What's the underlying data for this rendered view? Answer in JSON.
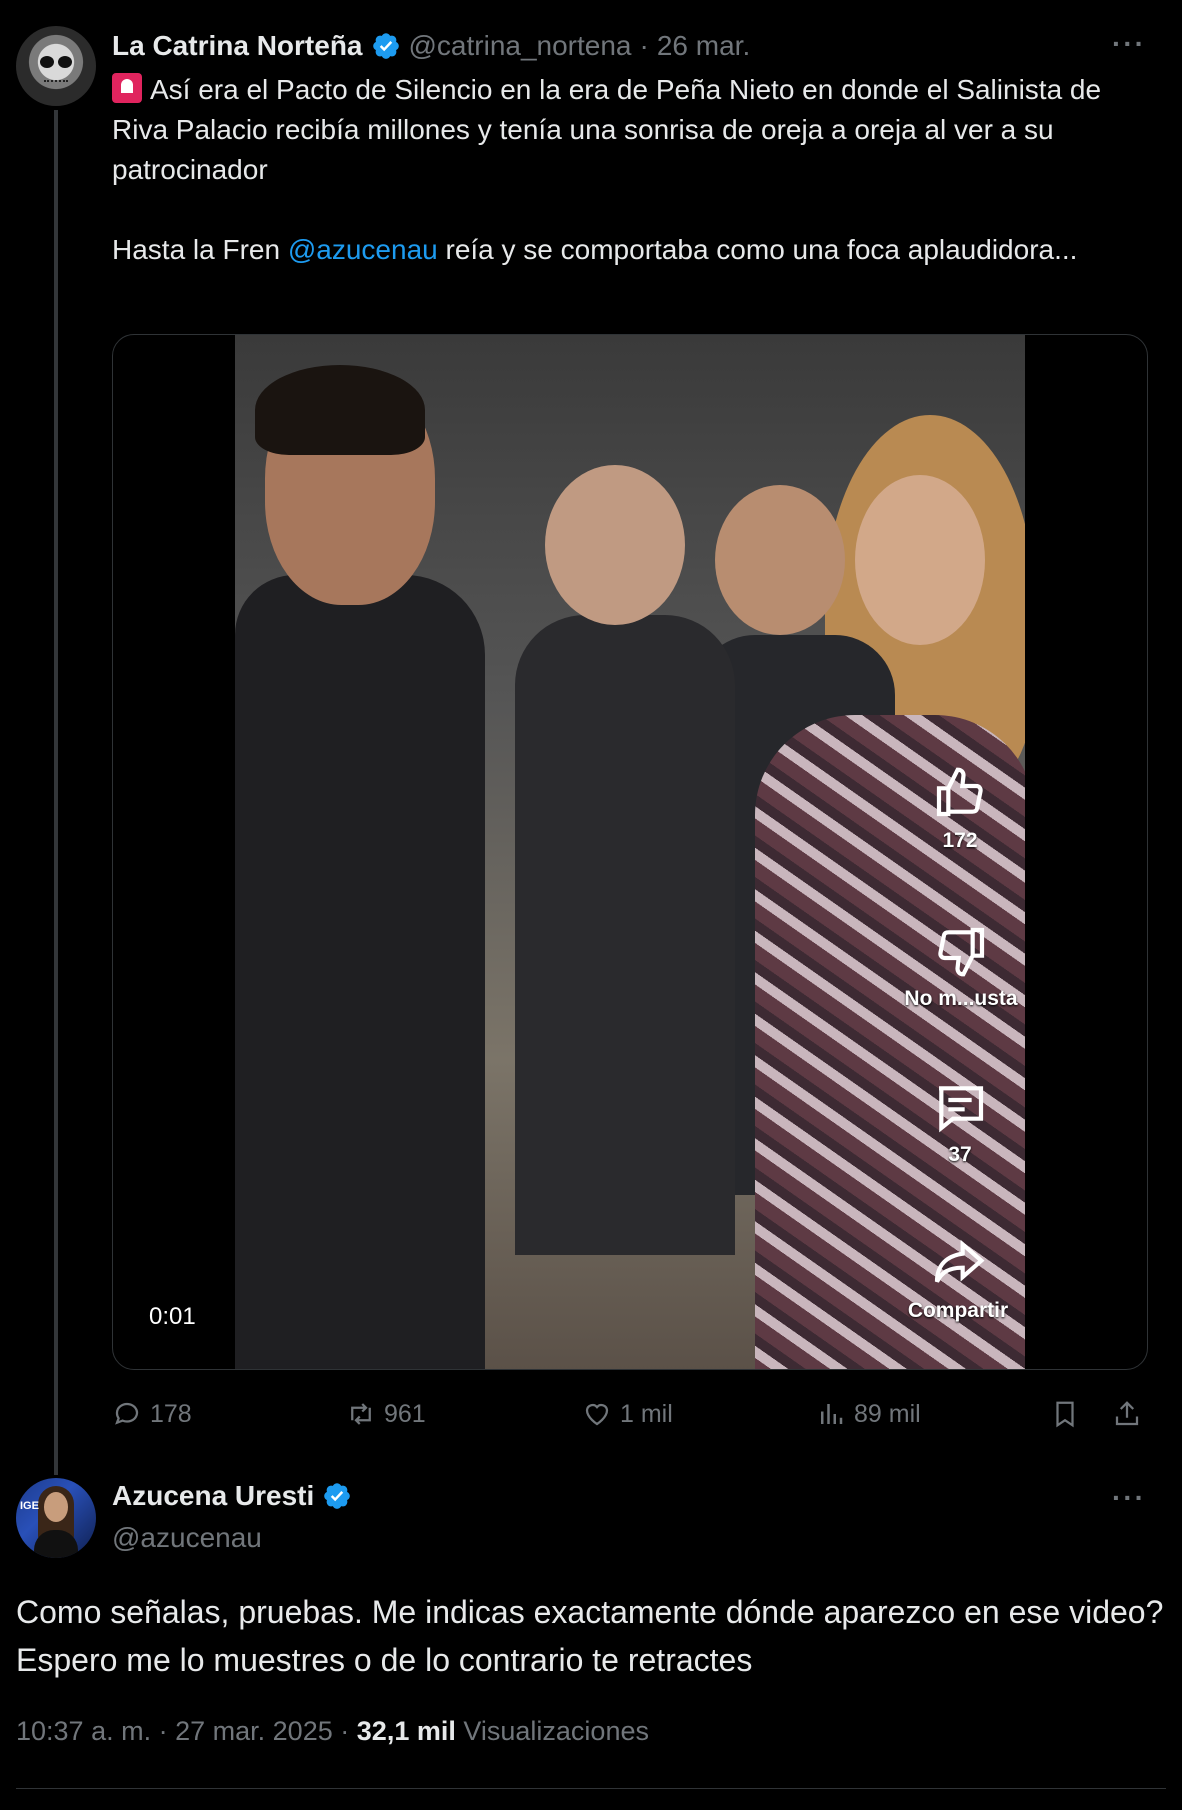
{
  "tweet1": {
    "name": "La Catrina Norteña",
    "handle": "@catrina_nortena",
    "separator": "·",
    "date": "26 mar.",
    "more": "···",
    "text_line1": "Así era el Pacto de Silencio en la era de Peña Nieto en donde el Salinista de Riva Palacio recibía millones y tenía una sonrisa de oreja a oreja al ver a su patrocinador",
    "text_line2_prefix": "Hasta la Fren ",
    "text_line2_mention": "@azucenau",
    "text_line2_suffix": " reía y se comportaba como una foca aplaudidora...",
    "video": {
      "time": "0:01",
      "like_count": "172",
      "dislike_label": "No m...usta",
      "comment_count": "37",
      "share_label": "Compartir"
    },
    "actions": {
      "replies": "178",
      "reposts": "961",
      "likes": "1 mil",
      "views": "89 mil"
    }
  },
  "tweet2": {
    "name": "Azucena Uresti",
    "handle": "@azucenau",
    "more": "···",
    "avatar_tag": "IGE",
    "text": "Como señalas, pruebas. Me indicas exactamente dónde aparezco en ese video? Espero me lo muestres o de lo contrario te retractes",
    "time": "10:37 a. m.",
    "date": "27 mar. 2025",
    "separator": "·",
    "views_count": "32,1 mil",
    "views_label": "Visualizaciones"
  },
  "colors": {
    "background": "#000000",
    "text": "#e7e9ea",
    "muted": "#71767b",
    "link": "#1d9bf0",
    "verified": "#1d9bf0"
  },
  "icons": [
    "siren-icon",
    "verified-icon",
    "more-icon",
    "reply-icon",
    "repost-icon",
    "like-icon",
    "views-icon",
    "bookmark-icon",
    "share-icon",
    "thumbs-up-icon",
    "thumbs-down-icon",
    "comment-icon",
    "share-arrow-icon"
  ]
}
